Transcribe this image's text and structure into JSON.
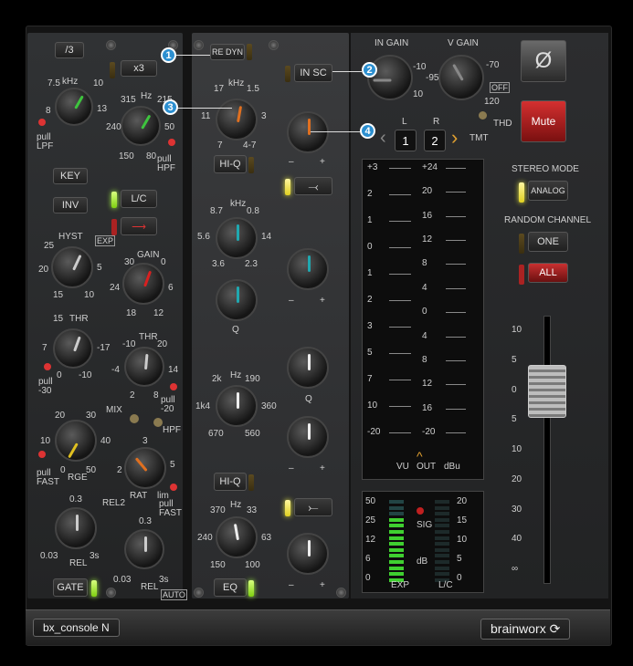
{
  "footer": {
    "product": "bx_console N",
    "brand": "brainworx"
  },
  "left_strip": {
    "div3": "/3",
    "x3": "x3",
    "lpf_unit": "kHz",
    "lpf_ticks": [
      "7.5",
      "10",
      "13",
      "8",
      "1"
    ],
    "lpf_pull": "pull\nLPF",
    "hpf_unit": "Hz",
    "hpf_ticks": [
      "315",
      "215",
      "240",
      "50",
      "150",
      "80"
    ],
    "hpf_pull": "pull\nHPF",
    "key": "KEY",
    "inv": "INV",
    "lc": "L/C",
    "hyst": "HYST",
    "exp": "EXP",
    "hyst_ticks": [
      "25",
      "5",
      "20",
      "15",
      "10"
    ],
    "gain": "GAIN",
    "gain_ticks": [
      "30",
      "0",
      "24",
      "6",
      "18",
      "12"
    ],
    "thr1": "THR",
    "thr1_ticks": [
      "15",
      "7",
      "0",
      "-10",
      "-17"
    ],
    "pull30": "pull\n-30",
    "thr2": "THR",
    "thr2_ticks": [
      "-10",
      "20",
      "-4",
      "14",
      "2",
      "8"
    ],
    "pull20": "pull\n-20",
    "mix": "MIX",
    "hpf": "HPF",
    "rge": "RGE",
    "rge_ticks": [
      "20",
      "30",
      "10",
      "40",
      "0",
      "50"
    ],
    "pull_fast": "pull\nFAST",
    "rat": "RAT",
    "rat_ticks": [
      "3",
      "2",
      "5",
      "1",
      "lim"
    ],
    "pull_fast2": "pull\nFAST",
    "rel1": "REL",
    "rel1_ticks": [
      "0.3",
      "0.03",
      "3s"
    ],
    "rel2_label": "REL2",
    "rel2": "REL",
    "rel2_ticks": [
      "0.3",
      "0.03",
      "3s"
    ],
    "auto": "AUTO",
    "gate": "GATE"
  },
  "mid_strip": {
    "re_dyn": "RE DYN",
    "in_sc": "IN SC",
    "band1_unit": "kHz",
    "band1_ticks": [
      "17",
      "1.5",
      "11",
      "3",
      "7",
      "4-7"
    ],
    "hiq1": "HI-Q",
    "band2_unit": "kHz",
    "band2_ticks": [
      "8.7",
      "0.8",
      "5.6",
      "14",
      "3.6",
      "2.3"
    ],
    "q1": "Q",
    "band3_unit": "Hz",
    "band3_ticks": [
      "2k",
      "190",
      "1k4",
      "360",
      "670",
      "560"
    ],
    "q2": "Q",
    "hiq2": "HI-Q",
    "band4_unit": "Hz",
    "band4_ticks": [
      "370",
      "33",
      "240",
      "63",
      "150",
      "100"
    ],
    "eq": "EQ",
    "minus": "–",
    "plus": "+"
  },
  "right_strip": {
    "in_gain": "IN GAIN",
    "in_gain_ticks": [
      "-10",
      "10"
    ],
    "v_gain": "V GAIN",
    "v_gain_ticks": [
      "-95",
      "-70",
      "120"
    ],
    "off": "OFF",
    "phase": "Ø",
    "mute": "Mute",
    "l": "L",
    "r": "R",
    "ch1": "1",
    "ch2": "2",
    "tmt": "TMT",
    "thd": "THD",
    "stereo_mode": "STEREO MODE",
    "analog": "ANALOG",
    "random_channel": "RANDOM CHANNEL",
    "one": "ONE",
    "all": "ALL",
    "vu_scale": [
      "+3",
      "2",
      "1",
      "0",
      "1",
      "2",
      "3",
      "5",
      "7",
      "10",
      "-20"
    ],
    "dbu_scale": [
      "+24",
      "20",
      "16",
      "12",
      "8",
      "4",
      "0",
      "4",
      "8",
      "12",
      "16",
      "-20"
    ],
    "vu": "VU",
    "out": "OUT",
    "dbu": "dBu",
    "exp_scale": [
      "50",
      "25",
      "12",
      "6",
      "0"
    ],
    "lc_scale": [
      "20",
      "15",
      "10",
      "5",
      "0"
    ],
    "sig": "SIG",
    "db": "dB",
    "exp": "EXP",
    "lc": "L/C",
    "fader_scale": [
      "10",
      "5",
      "0",
      "5",
      "10",
      "20",
      "30",
      "40",
      "∞"
    ]
  },
  "callouts": [
    "1",
    "2",
    "3",
    "4"
  ]
}
